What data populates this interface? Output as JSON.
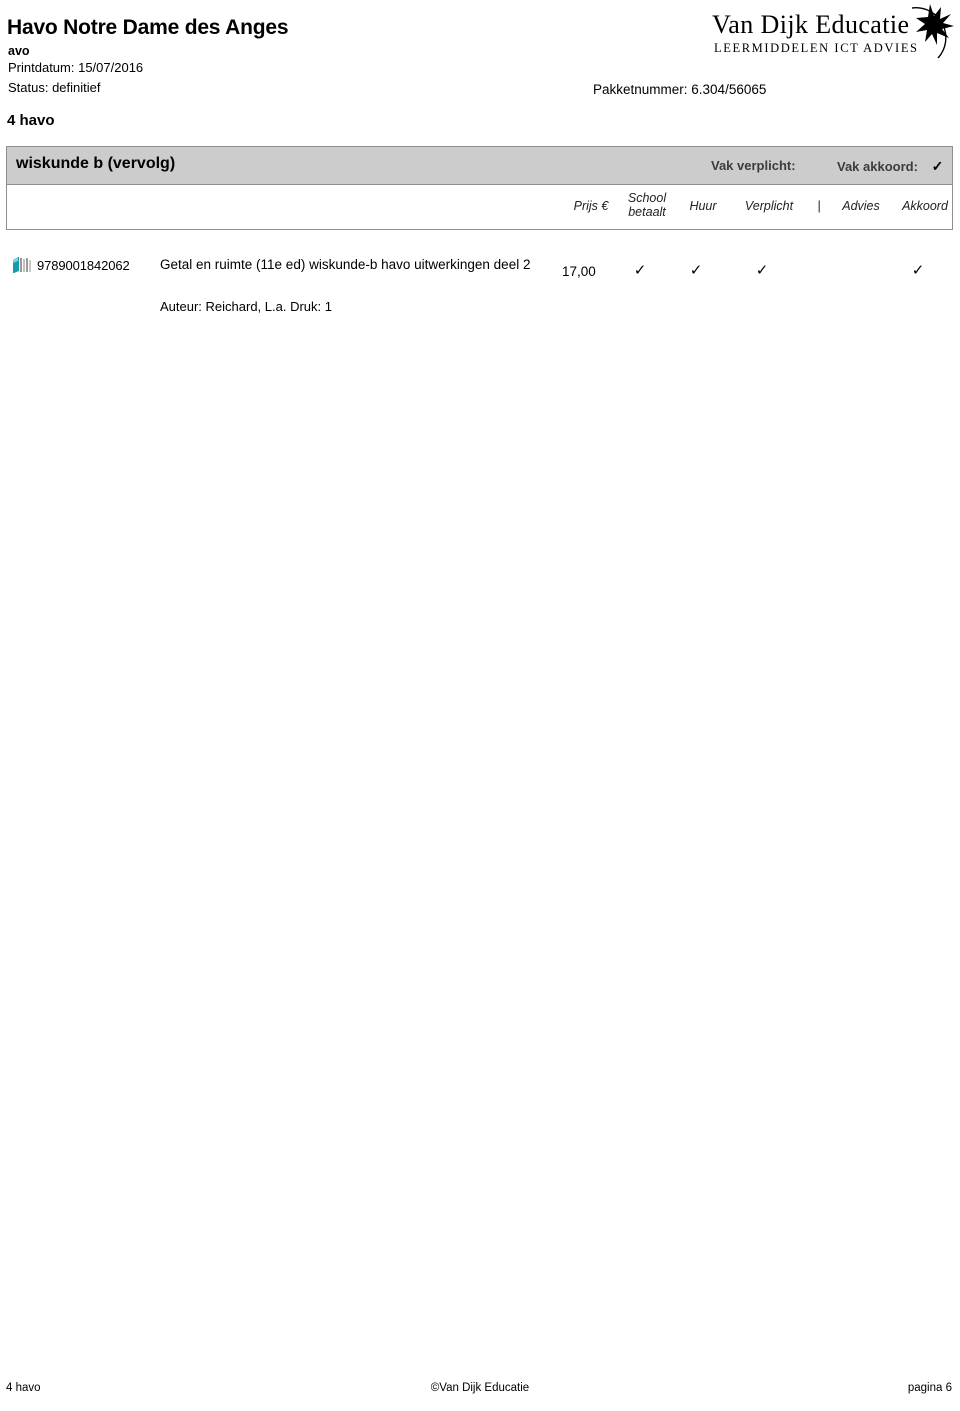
{
  "header": {
    "school_name": "Havo Notre Dame des Anges",
    "school_type": "avo",
    "printdatum": "Printdatum: 15/07/2016",
    "status": "Status: definitief",
    "pakketnummer": "Pakketnummer: 6.304/56065"
  },
  "logo": {
    "name": "Van Dijk Educatie",
    "tagline": "LEERMIDDELEN ICT ADVIES"
  },
  "grade": {
    "title": "4 havo"
  },
  "subject": {
    "name": "wiskunde b (vervolg)",
    "vak_verplicht_label": "Vak verplicht:",
    "vak_verplicht_value": "",
    "vak_akkoord_label": "Vak akkoord:",
    "vak_akkoord_value": "✓"
  },
  "columns": {
    "prijs": "Prijs €",
    "school_betaalt_line1": "School",
    "school_betaalt_line2": "betaalt",
    "huur": "Huur",
    "verplicht": "Verplicht",
    "separator": "|",
    "advies": "Advies",
    "akkoord": "Akkoord"
  },
  "books": [
    {
      "isbn": "9789001842062",
      "title": "Getal en ruimte (11e ed) wiskunde-b havo uitwerkingen deel 2",
      "author": "Auteur: Reichard, L.a.   Druk: 1",
      "prijs": "17,00",
      "school_betaalt": "✓",
      "huur": "✓",
      "verplicht": "✓",
      "advies": "",
      "akkoord": "✓"
    }
  ],
  "footer": {
    "left": "4 havo",
    "center": "©Van Dijk Educatie",
    "right": "pagina 6"
  },
  "colors": {
    "band_gray": "#cccccc",
    "border_gray": "#8f8f8f",
    "book_icon_teal": "#1a9aa8"
  }
}
